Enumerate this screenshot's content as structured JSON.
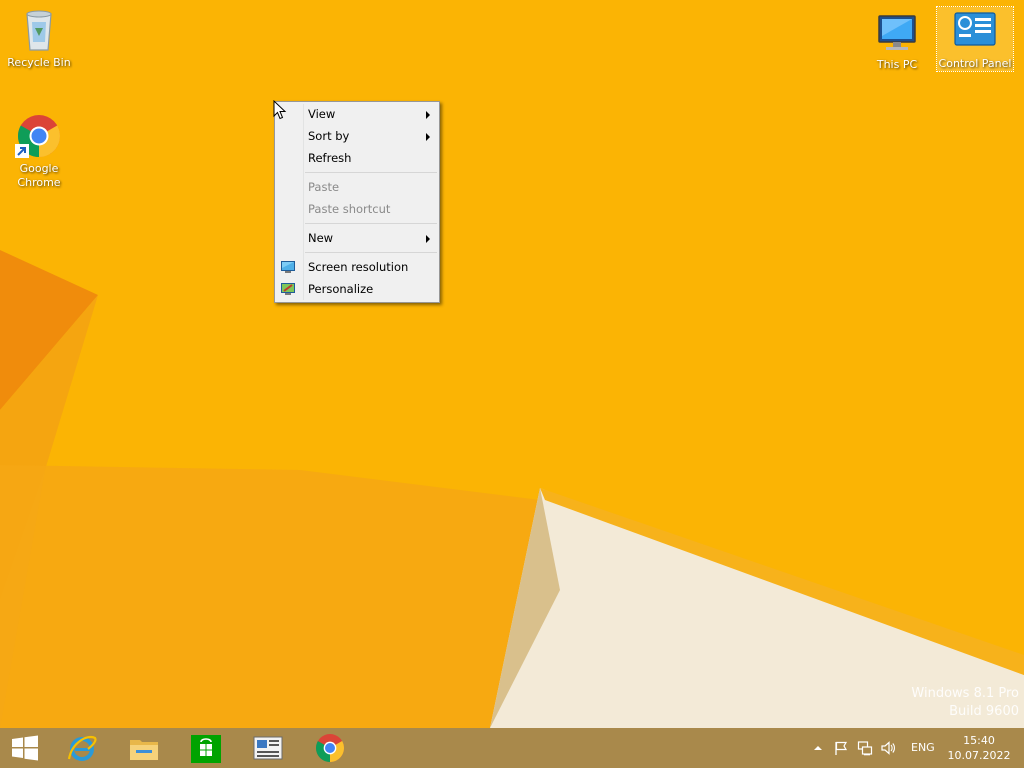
{
  "desktop": {
    "icons": [
      {
        "label": "Recycle Bin",
        "icon": "recycle-bin-icon"
      },
      {
        "label_line1": "Google",
        "label_line2": "Chrome",
        "icon": "chrome-icon"
      },
      {
        "label": "This PC",
        "icon": "computer-icon"
      },
      {
        "label": "Control Panel",
        "icon": "control-panel-icon"
      }
    ],
    "wallpaper_color": "#fbb404"
  },
  "context_menu": {
    "items": [
      {
        "label": "View",
        "has_submenu": true,
        "enabled": true
      },
      {
        "label": "Sort by",
        "has_submenu": true,
        "enabled": true
      },
      {
        "label": "Refresh",
        "has_submenu": false,
        "enabled": true
      },
      {
        "label": "Paste",
        "has_submenu": false,
        "enabled": false
      },
      {
        "label": "Paste shortcut",
        "has_submenu": false,
        "enabled": false
      },
      {
        "label": "New",
        "has_submenu": true,
        "enabled": true
      },
      {
        "label": "Screen resolution",
        "icon": "screen-resolution-icon",
        "enabled": true
      },
      {
        "label": "Personalize",
        "icon": "personalize-icon",
        "enabled": true
      }
    ]
  },
  "watermark": {
    "line1": "Windows 8.1 Pro",
    "line2": "Build 9600"
  },
  "taskbar": {
    "color": "#a9894b",
    "pinned": [
      {
        "name": "start-button",
        "icon": "windows-logo-icon"
      },
      {
        "name": "internet-explorer",
        "icon": "internet-explorer-icon"
      },
      {
        "name": "file-explorer",
        "icon": "file-explorer-icon"
      },
      {
        "name": "store",
        "icon": "store-icon"
      },
      {
        "name": "news-app",
        "icon": "news-icon"
      },
      {
        "name": "chrome",
        "icon": "chrome-icon"
      }
    ],
    "tray": {
      "language": "ENG",
      "time": "15:40",
      "date": "10.07.2022"
    }
  }
}
